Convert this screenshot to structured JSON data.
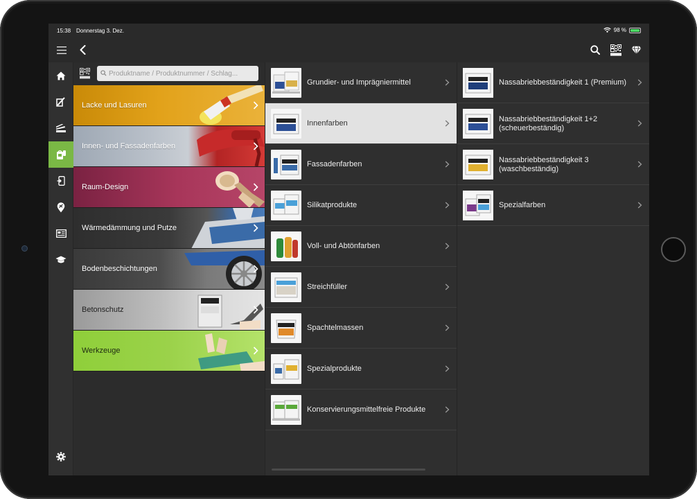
{
  "status": {
    "time": "15:38",
    "date": "Donnerstag 3. Dez.",
    "battery": "98 %",
    "battery_level": 0.98
  },
  "navbar": {
    "icons": [
      "menu-icon",
      "back-icon",
      "search-icon",
      "qr-scan-icon",
      "diamond-icon"
    ]
  },
  "sidebar": {
    "items": [
      "home-icon",
      "brush-icon",
      "samples-icon",
      "paint-bucket-icon",
      "device-icon",
      "location-icon",
      "catalog-icon",
      "education-icon",
      "settings-icon"
    ],
    "active_index": 3
  },
  "search": {
    "placeholder": "Produktname / Produktnummer / Schlag...",
    "qr_label": "SCAN"
  },
  "categories": [
    {
      "label": "Lacke und Lasuren",
      "accent": "#e2a21a"
    },
    {
      "label": "Innen- und Fassadenfarben",
      "accent": "#c42a2a"
    },
    {
      "label": "Raum-Design",
      "accent": "#a8365a"
    },
    {
      "label": "Wärmedämmung und Putze",
      "accent": "#3a6ba8"
    },
    {
      "label": "Bodenbeschichtungen",
      "accent": "#2f5fa8"
    },
    {
      "label": "Betonschutz",
      "accent": "#c9c9c9"
    },
    {
      "label": "Werkzeuge",
      "accent": "#9bd24a"
    }
  ],
  "subcategories": [
    {
      "label": "Grundier- und Imprägniermittel"
    },
    {
      "label": "Innenfarben",
      "active": true
    },
    {
      "label": "Fassadenfarben"
    },
    {
      "label": "Silikatprodukte"
    },
    {
      "label": "Voll- und Abtönfarben"
    },
    {
      "label": "Streichfüller"
    },
    {
      "label": "Spachtelmassen"
    },
    {
      "label": "Spezialprodukte"
    },
    {
      "label": "Konservierungsmittelfreie Produkte"
    }
  ],
  "details": [
    {
      "label": "Nassabriebbeständigkeit 1 (Premium)"
    },
    {
      "label": "Nassabriebbeständigkeit 1+2 (scheuerbeständig)"
    },
    {
      "label": "Nassabriebbeständigkeit 3 (waschbeständig)"
    },
    {
      "label": "Spezialfarben"
    }
  ],
  "brand": {
    "accent": "#7ab845"
  }
}
